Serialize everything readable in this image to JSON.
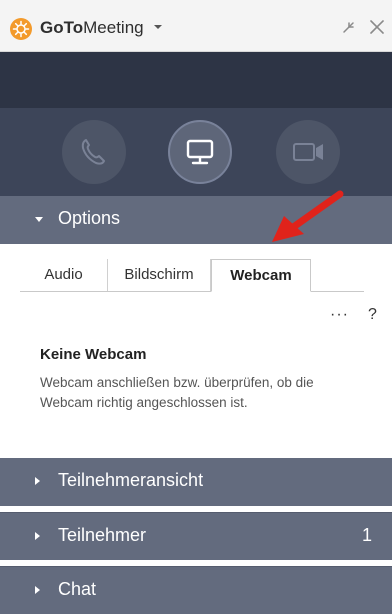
{
  "titlebar": {
    "brand_bold": "GoTo",
    "brand_rest": "Meeting",
    "icons": [
      "gotomeeting-logo-icon",
      "chevron-down-icon",
      "pin-icon",
      "close-icon"
    ]
  },
  "controls": {
    "buttons": [
      "phone-icon",
      "screen-share-icon",
      "webcam-icon"
    ]
  },
  "options": {
    "label": "Options",
    "tabs": [
      {
        "label": "Audio",
        "active": false
      },
      {
        "label": "Bildschirm",
        "active": false
      },
      {
        "label": "Webcam",
        "active": true
      }
    ],
    "more": "···",
    "help": "?",
    "webcam_title": "Keine Webcam",
    "webcam_desc": "Webcam anschließen bzw. überprüfen, ob die Webcam richtig angeschlossen ist."
  },
  "sections": [
    {
      "label": "Teilnehmeransicht",
      "count": ""
    },
    {
      "label": "Teilnehmer",
      "count": "1"
    },
    {
      "label": "Chat",
      "count": ""
    }
  ],
  "colors": {
    "dark_header": "#2d3445",
    "controls_bg": "#3d4559",
    "section_bg": "#636b7e",
    "logo": "#f39a2b",
    "annotation_arrow": "#e0231b"
  }
}
